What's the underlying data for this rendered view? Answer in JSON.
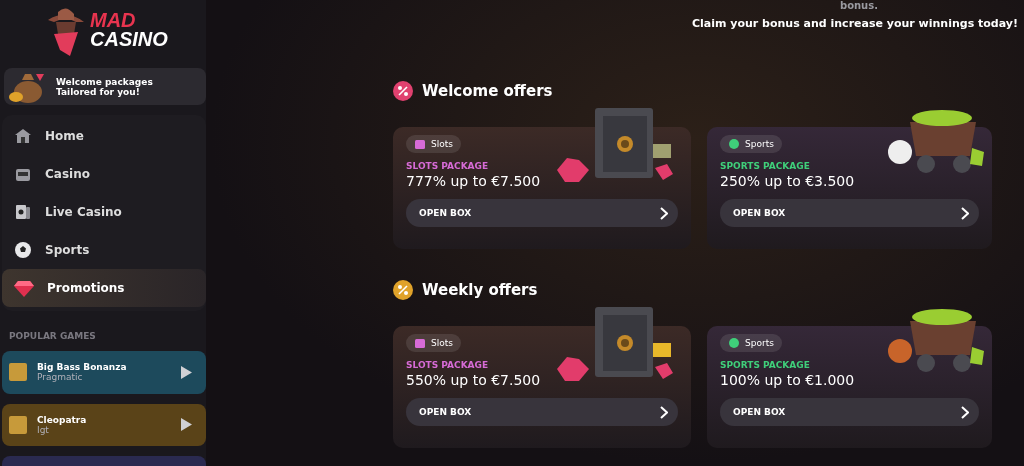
{
  "logo": {
    "line_1": "MAD",
    "line_2": "CASINO"
  },
  "promo_banner": {
    "title": "Welcome packages",
    "subtitle": "Tailored for you!"
  },
  "nav": [
    {
      "label": "Home",
      "kind": "home",
      "selected": false
    },
    {
      "label": "Casino",
      "kind": "slot",
      "selected": false
    },
    {
      "label": "Live Casino",
      "kind": "cards",
      "selected": false
    },
    {
      "label": "Sports",
      "kind": "ball",
      "selected": false
    },
    {
      "label": "Promotions",
      "kind": "gem",
      "selected": true
    }
  ],
  "popular_games": {
    "heading": "POPULAR GAMES",
    "items": [
      {
        "name": "Big Bass Bonanza",
        "provider": "Pragmatic",
        "color": "#1d4a5c"
      },
      {
        "name": "Cleopatra",
        "provider": "Igt",
        "color": "#5a4318"
      }
    ]
  },
  "intro": {
    "cut_text": "bonus.",
    "text": "Claim your bonus and increase your winnings today!"
  },
  "sections": [
    {
      "title": "Welcome offers",
      "color": "#e0416f",
      "offers": [
        {
          "kind": "slots",
          "tag": "Slots",
          "package": "SLOTS PACKAGE",
          "amount": "777% up to €7.500",
          "button": "OPEN BOX",
          "color": "#d76bd6"
        },
        {
          "kind": "sports",
          "tag": "Sports",
          "package": "SPORTS PACKAGE",
          "amount": "250% up to €3.500",
          "button": "OPEN BOX",
          "color": "#3fcf7a"
        }
      ]
    },
    {
      "title": "Weekly offers",
      "color": "#e0a22a",
      "offers": [
        {
          "kind": "slots",
          "tag": "Slots",
          "package": "SLOTS PACKAGE",
          "amount": "550% up to €7.500",
          "button": "OPEN BOX",
          "color": "#d76bd6"
        },
        {
          "kind": "sports",
          "tag": "Sports",
          "package": "SPORTS PACKAGE",
          "amount": "100% up to €1.000",
          "button": "OPEN BOX",
          "color": "#3fcf7a"
        }
      ]
    }
  ]
}
